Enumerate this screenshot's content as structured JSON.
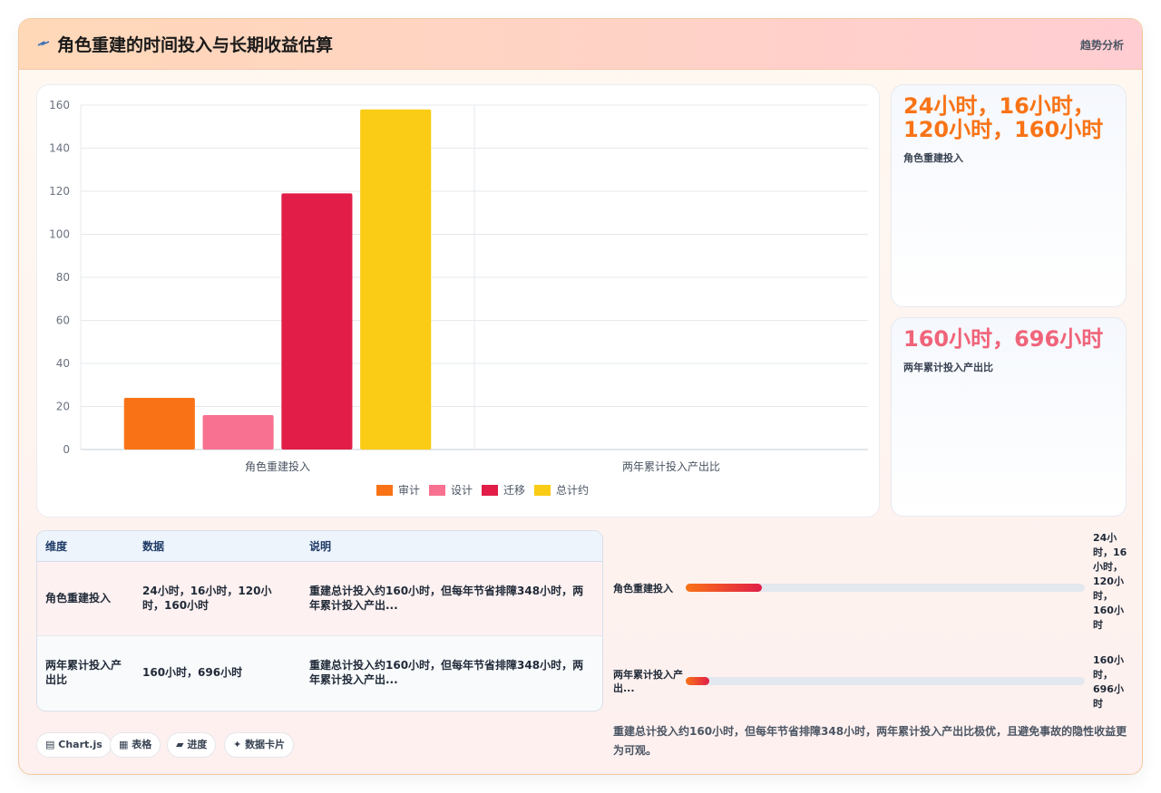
{
  "header": {
    "title": "角色重建的时间投入与长期收益估算",
    "trend_label": "趋势分析",
    "accent": "#f97316"
  },
  "chart_data": {
    "type": "bar",
    "categories": [
      "角色重建投入",
      "两年累计投入产出比"
    ],
    "series": [
      {
        "name": "审计",
        "color": "#f97316",
        "values": [
          24,
          null
        ]
      },
      {
        "name": "设计",
        "color": "#f87191",
        "values": [
          16,
          null
        ]
      },
      {
        "name": "迁移",
        "color": "#e11d48",
        "values": [
          119,
          null
        ]
      },
      {
        "name": "总计约",
        "color": "#facc15",
        "values": [
          158,
          null
        ]
      }
    ],
    "yticks": [
      0,
      20,
      40,
      60,
      80,
      100,
      120,
      140,
      160
    ],
    "ylim": [
      0,
      160
    ],
    "grid": true,
    "legend": "bottom"
  },
  "kpis": [
    {
      "value": "24小时，16小时，120小时，160小时",
      "label": "角色重建投入",
      "color": "#f97316"
    },
    {
      "value": "160小时，696小时",
      "label": "两年累计投入产出比",
      "color": "#f0647a"
    }
  ],
  "table": {
    "headers": [
      "维度",
      "数据",
      "说明"
    ],
    "rows": [
      [
        "角色重建投入",
        "24小时，16小时，120小时，160小时",
        "重建总计投入约160小时，但每年节省排障348小时，两年累计投入产出..."
      ],
      [
        "两年累计投入产出比",
        "160小时，696小时",
        "重建总计投入约160小时，但每年节省排障348小时，两年累计投入产出..."
      ]
    ]
  },
  "progress": [
    {
      "label": "角色重建投入",
      "value_text": "24小时，16小时，120小时，160小时",
      "fraction": 0.19
    },
    {
      "label": "两年累计投入产出...",
      "value_text": "160小时，696小时",
      "fraction": 0.06
    }
  ],
  "summary": "重建总计投入约160小时，但每年节省排障348小时，两年累计投入产出比极优，且避免事故的隐性收益更为可观。",
  "chips": [
    {
      "icon": "chart-icon",
      "label": "Chart.js"
    },
    {
      "icon": "table-icon",
      "label": "表格"
    },
    {
      "icon": "progress-icon",
      "label": "进度"
    },
    {
      "icon": "sparkle-icon",
      "label": "数据卡片"
    }
  ]
}
